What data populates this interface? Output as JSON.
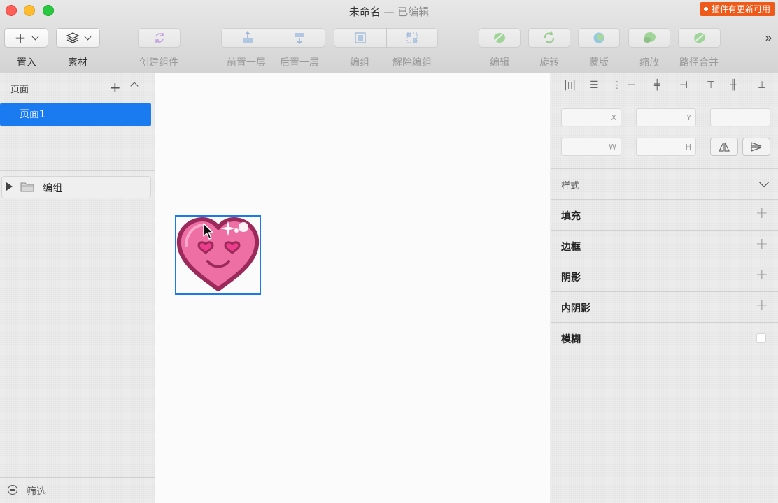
{
  "window": {
    "title": "未命名",
    "status": "— 已编辑",
    "plugin_badge": "插件有更新可用"
  },
  "toolbar": {
    "insert": "置入",
    "assets": "素材",
    "create_component": "创建组件",
    "bring_forward": "前置一层",
    "send_backward": "后置一层",
    "group": "编组",
    "ungroup": "解除编组",
    "edit": "编辑",
    "rotate": "旋转",
    "mask": "蒙版",
    "scale": "缩放",
    "path_combine": "路径合并",
    "more": "»"
  },
  "sidebar": {
    "pages_header": "页面",
    "page_name": "页面1",
    "layer_name": "编组",
    "filter_label": "筛选"
  },
  "inspector": {
    "x_label": "X",
    "y_label": "Y",
    "w_label": "W",
    "h_label": "H",
    "style_label": "样式",
    "fill_label": "填充",
    "border_label": "边框",
    "shadow_label": "阴影",
    "inner_shadow_label": "内阴影",
    "blur_label": "模糊"
  },
  "colors": {
    "accent": "#1a7bf0",
    "badge": "#ee5a1a",
    "heart_fill": "#ee6fa3",
    "heart_outline": "#9b2a5b"
  }
}
